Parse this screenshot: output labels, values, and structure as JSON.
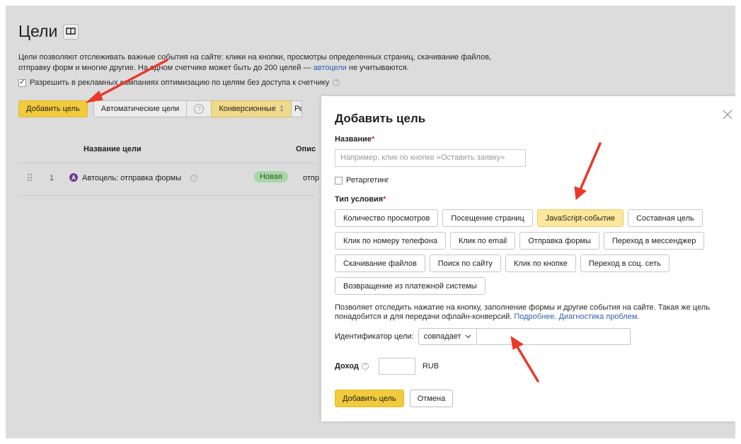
{
  "page": {
    "title": "Цели",
    "description_1": "Цели позволяют отслеживать важные события на сайте: клики на кнопки, просмотры определенных страниц, скачивание файлов,",
    "description_2": "отправку форм и многие другие. На одном счетчике может быть до 200 целей — ",
    "autogoals_link": "автоцели",
    "description_3": " не учитываются.",
    "allow_text": "Разрешить в рекламных кампаниях оптимизацию по целям без доступа к счетчику",
    "add_goal_button": "Добавить цель",
    "auto_goals_tab": "Автоматические цели",
    "conversion_tab": "Конверсионные",
    "conversion_count": "1",
    "retarget_tab_partial": "Ре",
    "col_name": "Название цели",
    "col_desc_partial": "Опис",
    "row": {
      "index": "1",
      "name": "Автоцель: отправка формы",
      "badge": "Новая",
      "desc_partial": "отпр"
    }
  },
  "modal": {
    "title": "Добавить цель",
    "name_label": "Название",
    "name_placeholder": "Например, клик по кнопке «Оставить заявку»",
    "retargeting_label": "Ретаргетинг",
    "type_label": "Тип условия",
    "types": [
      [
        "Количество просмотров",
        "Посещение страниц",
        "JavaScript-событие",
        "Составная цель"
      ],
      [
        "Клик по номеру телефона",
        "Клик по email",
        "Отправка формы",
        "Переход в мессенджер"
      ],
      [
        "Скачивание файлов",
        "Поиск по сайту",
        "Клик по кнопке",
        "Переход в соц. сеть"
      ],
      [
        "Возвращение из платежной системы"
      ]
    ],
    "active_type": "JavaScript-событие",
    "hint_1": "Позволяет отследить нажатие на кнопку, заполнение формы и другие события на сайте. Такая же цель",
    "hint_2": "понадобится и для передачи офлайн-конверсий. ",
    "more_link": "Подробнее",
    "diag_link": "Диагностика проблем",
    "ident_label": "Идентификатор цели:",
    "match_value": "совпадает",
    "income_label": "Доход",
    "currency": "RUB",
    "submit_button": "Добавить цель",
    "cancel_button": "Отмена"
  },
  "colors": {
    "accent_yellow": "#f2cb3c",
    "active_type_bg": "#fde79a",
    "link_blue": "#2e5fb3",
    "arrow_red": "#e8392b"
  }
}
